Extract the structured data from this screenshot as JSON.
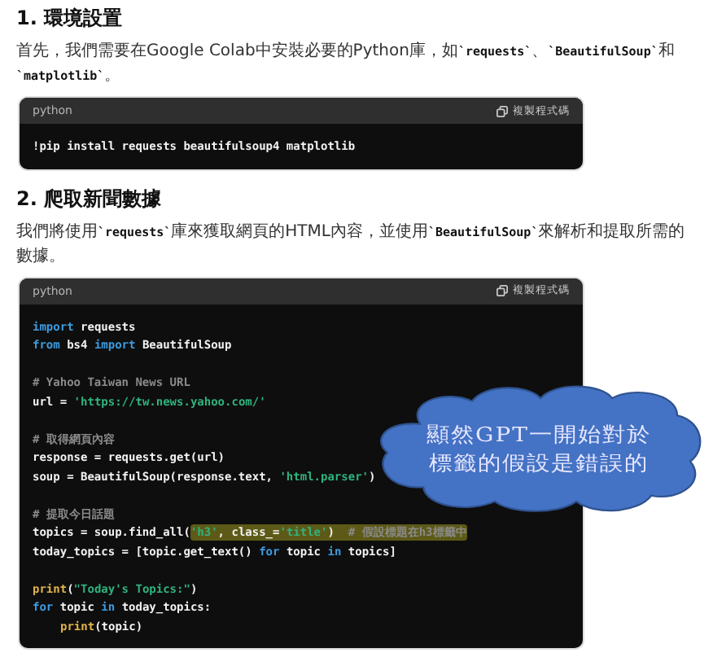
{
  "sections": [
    {
      "heading": "1. 環境設置",
      "paragraph": [
        {
          "kind": "text",
          "text": "首先，我們需要在Google Colab中安裝必要的Python庫，如"
        },
        {
          "kind": "code",
          "text": "`requests`"
        },
        {
          "kind": "text",
          "text": "、"
        },
        {
          "kind": "code",
          "text": "`BeautifulSoup`"
        },
        {
          "kind": "text",
          "text": "和 "
        },
        {
          "kind": "code",
          "text": "`matplotlib`"
        },
        {
          "kind": "text",
          "text": "。"
        }
      ],
      "code_block": {
        "language": "python",
        "copy_label": "複製程式碼",
        "groups": [
          [
            {
              "tokens": [
                {
                  "kind": "plain",
                  "text": "!pip install requests beautifulsoup4 matplotlib"
                }
              ]
            }
          ]
        ]
      }
    },
    {
      "heading": "2. 爬取新聞數據",
      "paragraph": [
        {
          "kind": "text",
          "text": "我們將使用"
        },
        {
          "kind": "code",
          "text": "`requests`"
        },
        {
          "kind": "text",
          "text": "庫來獲取網頁的HTML內容，並使用"
        },
        {
          "kind": "code",
          "text": "`BeautifulSoup`"
        },
        {
          "kind": "text",
          "text": "來解析和提取所需的數據。"
        }
      ],
      "code_block": {
        "language": "python",
        "copy_label": "複製程式碼",
        "groups": [
          [
            {
              "tokens": [
                {
                  "kind": "keyword",
                  "text": "import"
                },
                {
                  "kind": "plain",
                  "text": " requests"
                }
              ]
            },
            {
              "tokens": [
                {
                  "kind": "keyword",
                  "text": "from"
                },
                {
                  "kind": "plain",
                  "text": " bs4 "
                },
                {
                  "kind": "keyword",
                  "text": "import"
                },
                {
                  "kind": "plain",
                  "text": " BeautifulSoup"
                }
              ]
            }
          ],
          [
            {
              "tokens": [
                {
                  "kind": "comment",
                  "text": "# Yahoo Taiwan News URL"
                }
              ]
            },
            {
              "tokens": [
                {
                  "kind": "plain",
                  "text": "url = "
                },
                {
                  "kind": "string",
                  "text": "'https://tw.news.yahoo.com/'"
                }
              ]
            }
          ],
          [
            {
              "tokens": [
                {
                  "kind": "comment",
                  "text": "# 取得網頁內容"
                }
              ]
            },
            {
              "tokens": [
                {
                  "kind": "plain",
                  "text": "response = requests.get(url)"
                }
              ]
            },
            {
              "tokens": [
                {
                  "kind": "plain",
                  "text": "soup = BeautifulSoup(response.text, "
                },
                {
                  "kind": "string",
                  "text": "'html.parser'"
                },
                {
                  "kind": "plain",
                  "text": ")"
                }
              ]
            }
          ],
          [
            {
              "tokens": [
                {
                  "kind": "comment",
                  "text": "# 提取今日話題"
                }
              ]
            },
            {
              "tokens": [
                {
                  "kind": "plain",
                  "text": "topics = soup.find_all("
                }
              ],
              "highlighted_tokens": [
                {
                  "kind": "string",
                  "text": "'h3'"
                },
                {
                  "kind": "plain",
                  "text": ", class_="
                },
                {
                  "kind": "string",
                  "text": "'title'"
                },
                {
                  "kind": "plain",
                  "text": ")  "
                },
                {
                  "kind": "comment",
                  "text": "# 假設標題在h3標籤中"
                }
              ]
            },
            {
              "tokens": [
                {
                  "kind": "plain",
                  "text": "today_topics = [topic.get_text() "
                },
                {
                  "kind": "keyword",
                  "text": "for"
                },
                {
                  "kind": "plain",
                  "text": " topic "
                },
                {
                  "kind": "keyword",
                  "text": "in"
                },
                {
                  "kind": "plain",
                  "text": " topics]"
                }
              ]
            }
          ],
          [
            {
              "tokens": [
                {
                  "kind": "function",
                  "text": "print"
                },
                {
                  "kind": "plain",
                  "text": "("
                },
                {
                  "kind": "string",
                  "text": "\"Today's Topics:\""
                },
                {
                  "kind": "plain",
                  "text": ")"
                }
              ]
            },
            {
              "tokens": [
                {
                  "kind": "keyword",
                  "text": "for"
                },
                {
                  "kind": "plain",
                  "text": " topic "
                },
                {
                  "kind": "keyword",
                  "text": "in"
                },
                {
                  "kind": "plain",
                  "text": " today_topics:"
                }
              ]
            },
            {
              "indented": true,
              "tokens": [
                {
                  "kind": "function",
                  "text": "print"
                },
                {
                  "kind": "plain",
                  "text": "(topic)"
                }
              ]
            }
          ]
        ]
      }
    }
  ],
  "callout": {
    "lines": [
      "顯然GPT一開始對於",
      "標籤的假設是錯誤的"
    ]
  }
}
